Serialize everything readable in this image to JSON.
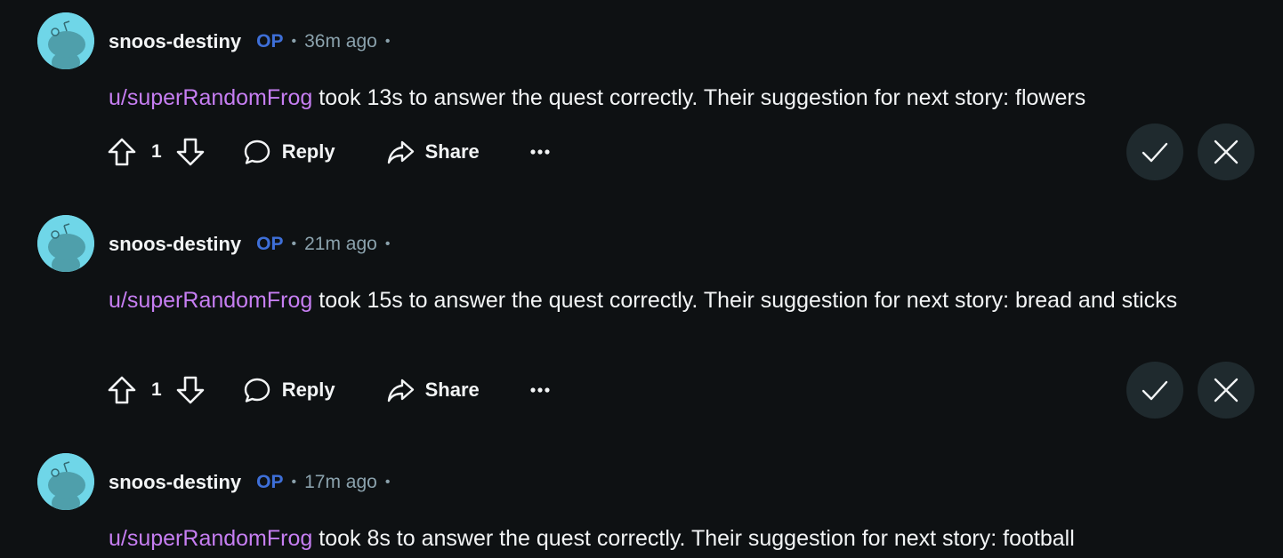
{
  "comments": [
    {
      "author": "snoos-destiny",
      "op_badge": "OP",
      "time": "36m ago",
      "username": "u/superRandomFrog",
      "text": " took 13s to answer the quest correctly. Their suggestion for next story: flowers",
      "score": "1",
      "reply_label": "Reply",
      "share_label": "Share"
    },
    {
      "author": "snoos-destiny",
      "op_badge": "OP",
      "time": "21m ago",
      "username": "u/superRandomFrog",
      "text": " took 15s to answer the quest correctly. Their suggestion for next story: bread and sticks",
      "score": "1",
      "reply_label": "Reply",
      "share_label": "Share"
    },
    {
      "author": "snoos-destiny",
      "op_badge": "OP",
      "time": "17m ago",
      "username": "u/superRandomFrog",
      "text": " took 8s to answer the quest correctly. Their suggestion for next story: football"
    }
  ],
  "icons": {
    "avatar": "snoo-avatar-icon",
    "upvote": "upvote-arrow-icon",
    "downvote": "downvote-arrow-icon",
    "reply": "speech-bubble-icon",
    "share": "share-arrow-icon",
    "more": "ellipsis-icon",
    "approve": "checkmark-icon",
    "remove": "x-icon"
  },
  "colors": {
    "background": "#0e1113",
    "username_link": "#c67ef2",
    "op_badge": "#3e6fd8",
    "meta_text": "#8ba2ad",
    "mod_button": "#1f2a2e",
    "avatar_bg": "#6fd6e8"
  }
}
